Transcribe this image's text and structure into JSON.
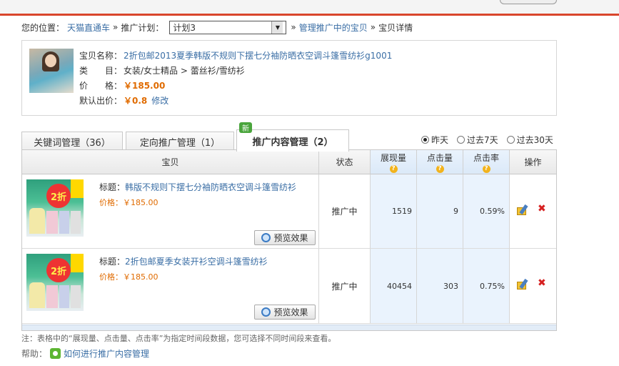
{
  "breadcrumb": {
    "label": "您的位置：",
    "home_link": "天猫直通车",
    "sep": "»",
    "plan_label": "推广计划：",
    "plan_value": "计划3",
    "managing_link": "管理推广中的宝贝",
    "current": "宝贝详情"
  },
  "item": {
    "name_label": "宝贝名称：",
    "name": "2折包邮2013夏季韩版不规则下摆七分袖防晒衣空调斗篷雪纺衫g1001",
    "category_label": "类　　目：",
    "category": "女装/女士精品 > 蕾丝衫/雪纺衫",
    "price_label": "价　　格：",
    "price": "￥185.00",
    "default_bid_label": "默认出价：",
    "default_bid": "￥0.8",
    "modify_link": "修改"
  },
  "tabs": [
    {
      "label": "关键词管理（36）"
    },
    {
      "label": "定向推广管理（1）"
    },
    {
      "label": "推广内容管理（2）"
    }
  ],
  "new_badge": "新",
  "period": {
    "options": [
      "昨天",
      "过去7天",
      "过去30天"
    ],
    "selected": "昨天"
  },
  "table": {
    "headers": {
      "item": "宝贝",
      "status": "状态",
      "impressions": "展现量",
      "clicks": "点击量",
      "ctr": "点击率",
      "ops": "操作"
    },
    "title_label": "标题：",
    "price_label": "价格：",
    "preview_label": "预览效果",
    "promo_badge": "2折",
    "rows": [
      {
        "title": "韩版不规则下摆七分袖防晒衣空调斗篷雪纺衫",
        "price": "￥185.00",
        "status": "推广中",
        "impressions": "1519",
        "clicks": "9",
        "ctr": "0.59%"
      },
      {
        "title": "2折包邮夏季女装开衫空调斗篷雪纺衫",
        "price": "￥185.00",
        "status": "推广中",
        "impressions": "40454",
        "clicks": "303",
        "ctr": "0.75%"
      }
    ]
  },
  "note": "注：表格中的“展现量、点击量、点击率”为指定时间段数据，您可选择不同时间段来查看。",
  "help": {
    "label": "帮助：",
    "link": "如何进行推广内容管理"
  }
}
